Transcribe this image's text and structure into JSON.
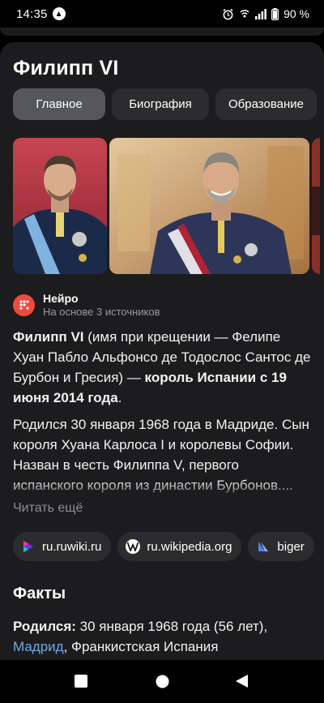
{
  "status": {
    "time": "14:35",
    "battery": "90 %"
  },
  "card": {
    "title": "Филипп VI",
    "tabs": [
      {
        "label": "Главное"
      },
      {
        "label": "Биография"
      },
      {
        "label": "Образование"
      }
    ]
  },
  "neiro": {
    "name": "Нейро",
    "subtitle": "На основе 3 источников"
  },
  "summary": {
    "p1_name": "Филипп VI",
    "p1_text": " (имя при крещении — Фелипе Хуан Пабло Альфонсо де Тодослос Сантос де Бурбон и Гресия) — ",
    "p1_bold": "король Испании с 19 июня 2014 года",
    "p1_end": ".",
    "p2_text": "Родился 30 января 1968 года в Мадриде. Сын короля Хуана Карлоса I и королевы Софии. Назван в честь Филиппа V, первого испанского короля из династии Бурбонов....",
    "read_more": "Читать ещё"
  },
  "sources": [
    {
      "label": "ru.ruwiki.ru",
      "icon": "ruwiki-icon"
    },
    {
      "label": "ru.wikipedia.org",
      "icon": "wikipedia-icon"
    },
    {
      "label": "biger",
      "icon": "biger-icon"
    }
  ],
  "facts": {
    "title": "Факты",
    "born_label": "Родился:",
    "born_value": " 30 января 1968 года (56 лет),",
    "born_place_link": "Мадрид",
    "born_place_rest": ", Франкистская Испания"
  },
  "colors": {
    "background": "#1c1c1e",
    "chip": "#2c2c2e",
    "active_tab": "#55575b",
    "link": "#6fa8e6",
    "neiro_accent": "#ef4a3c"
  }
}
